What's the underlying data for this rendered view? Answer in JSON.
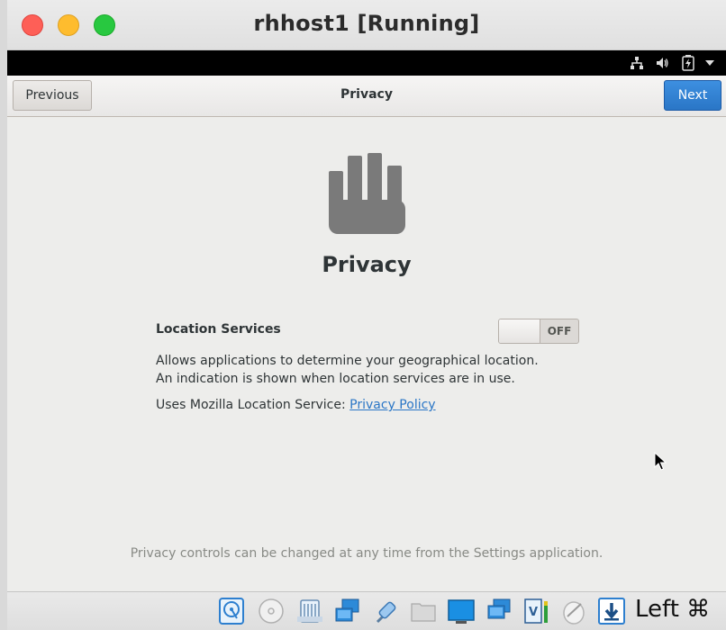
{
  "window": {
    "title": "rhhost1 [Running]"
  },
  "header": {
    "previous_label": "Previous",
    "title": "Privacy",
    "next_label": "Next"
  },
  "main": {
    "heading": "Privacy",
    "location_label": "Location Services",
    "switch_state": "OFF",
    "description": "Allows applications to determine your geographical location. An indication is shown when location services are in use.",
    "uses_text": "Uses Mozilla Location Service: ",
    "privacy_policy_link": "Privacy Policy",
    "footer_note": "Privacy controls can be changed at any time from the Settings application."
  },
  "tray": {
    "icons": [
      "network-icon",
      "volume-icon",
      "battery-icon",
      "dropdown-arrow-icon"
    ]
  },
  "statusbar": {
    "host_key": "Left ⌘",
    "icons": [
      "hard-disk-icon",
      "optical-drive-icon",
      "audio-icon",
      "network-icon",
      "usb-icon",
      "shared-folders-icon",
      "display-icon",
      "vm-windows-icon",
      "recording-icon",
      "mouse-integration-icon",
      "keyboard-capture-icon"
    ]
  },
  "colors": {
    "next_button": "#2a76c6",
    "link": "#2a76c6",
    "close": "#fe5f57",
    "minimize": "#febc2e",
    "maximize": "#28c840"
  }
}
